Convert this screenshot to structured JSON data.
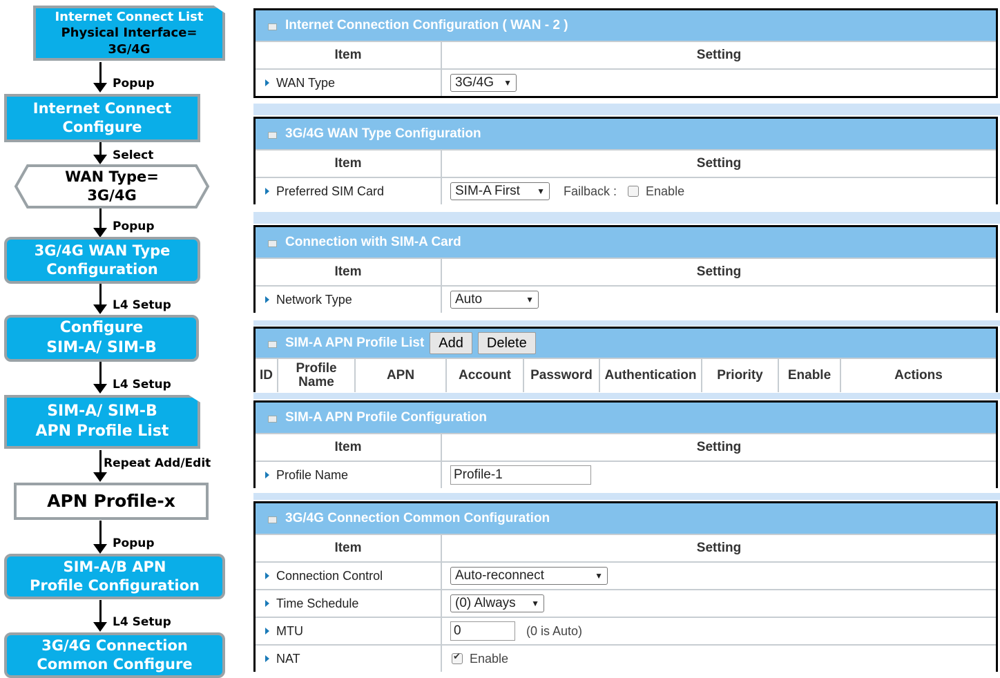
{
  "flowchart": {
    "box1": [
      "Internet Connect List",
      "Physical Interface=",
      "3G/4G"
    ],
    "arrow1": "Popup",
    "box2": [
      "Internet Connect",
      "Configure"
    ],
    "arrow2": "Select",
    "box3": [
      "WAN Type=",
      "3G/4G"
    ],
    "arrow3": "Popup",
    "box4": [
      "3G/4G WAN Type",
      "Configuration"
    ],
    "arrow4": "L4 Setup",
    "box5": [
      "Configure",
      "SIM-A/ SIM-B"
    ],
    "arrow5": "L4 Setup",
    "box6": [
      "SIM-A/ SIM-B",
      "APN Profile  List"
    ],
    "arrow6": "Repeat Add/Edit",
    "box7": "APN Profile-x",
    "arrow7": "Popup",
    "box8": [
      "SIM-A/B APN",
      "Profile Configuration"
    ],
    "arrow8": "L4 Setup",
    "box9": [
      "3G/4G Connection",
      "Common Configure"
    ]
  },
  "columns": {
    "item": "Item",
    "setting": "Setting"
  },
  "wan": {
    "title": "Internet Connection Configuration ( WAN - 2 )",
    "wan_type_label": "WAN Type",
    "wan_type_value": "3G/4G"
  },
  "wan_type_cfg": {
    "title": "3G/4G WAN Type Configuration",
    "sim_label": "Preferred SIM Card",
    "sim_value": "SIM-A First",
    "failback_label": "Failback :",
    "enable_label": "Enable"
  },
  "sim_a": {
    "title": "Connection with SIM-A Card",
    "network_label": "Network Type",
    "network_value": "Auto"
  },
  "apn_list": {
    "title": "SIM-A APN Profile List",
    "add": "Add",
    "delete": "Delete",
    "headers": [
      "ID",
      "Profile Name",
      "APN",
      "Account",
      "Password",
      "Authentication",
      "Priority",
      "Enable",
      "Actions"
    ]
  },
  "apn_cfg": {
    "title": "SIM-A APN Profile Configuration",
    "profile_label": "Profile Name",
    "profile_value": "Profile-1"
  },
  "common": {
    "title": "3G/4G Connection Common Configuration",
    "conn_label": "Connection Control",
    "conn_value": "Auto-reconnect",
    "sched_label": "Time Schedule",
    "sched_value": "(0) Always",
    "mtu_label": "MTU",
    "mtu_value": "0",
    "mtu_hint": "(0 is Auto)",
    "nat_label": "NAT",
    "nat_enable": "Enable"
  },
  "colors": {
    "flow_blue": "#0aaee8",
    "panel_header": "#82c1ec",
    "separator": "#cfe3f7"
  }
}
